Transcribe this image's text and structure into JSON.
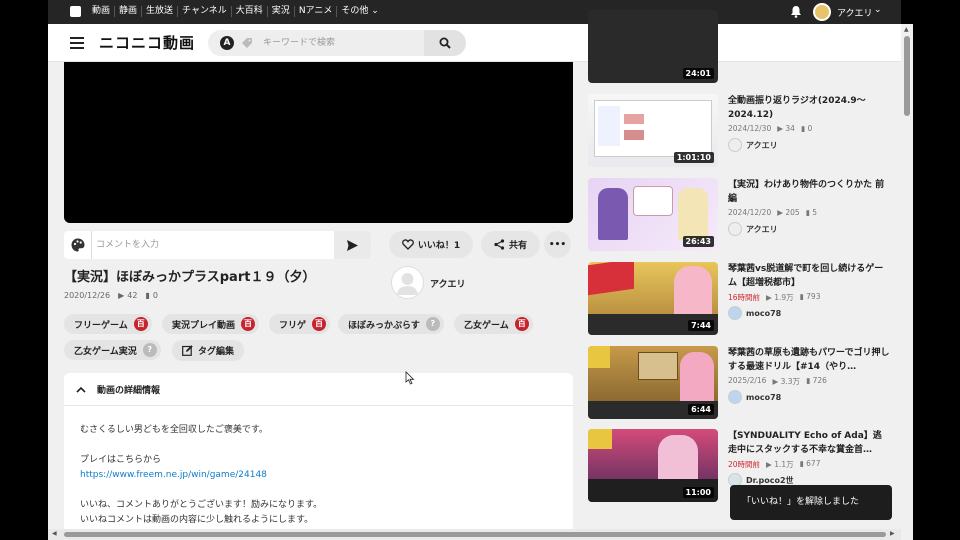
{
  "topbar": {
    "nav": [
      "動画",
      "静画",
      "生放送",
      "チャンネル",
      "大百科",
      "実況",
      "Nアニメ",
      "その他"
    ],
    "user_name": "アクエリ"
  },
  "header": {
    "brand": "ニコニコ動画",
    "search_placeholder": "キーワードで検索",
    "search_mode": "A"
  },
  "player": {
    "comment_placeholder": "コメントを入力",
    "like_label": "いいね！1",
    "share_label": "共有"
  },
  "video": {
    "title": "【実況】ほぼみっかプラスpart１９（夕）",
    "date": "2020/12/26",
    "views": "42",
    "comments": "0",
    "owner": "アクエリ"
  },
  "tags": [
    {
      "label": "フリーゲーム",
      "badge": "百",
      "badge_color": "red"
    },
    {
      "label": "実況プレイ動画",
      "badge": "百",
      "badge_color": "red"
    },
    {
      "label": "フリゲ",
      "badge": "百",
      "badge_color": "red"
    },
    {
      "label": "ほぼみっかぷらす",
      "badge": "?",
      "badge_color": "grey"
    },
    {
      "label": "乙女ゲーム",
      "badge": "百",
      "badge_color": "red"
    },
    {
      "label": "乙女ゲーム実況",
      "badge": "?",
      "badge_color": "grey"
    }
  ],
  "tag_edit_label": "タグ編集",
  "details": {
    "heading": "動画の詳細情報",
    "lines": [
      "むさくるしい男どもを全回収したご褒美です。",
      "",
      "プレイはこちらから",
      "https://www.freem.ne.jp/win/game/24148",
      "",
      "いいね、コメントありがとうございます！励みになります。",
      "いいねコメントは動画の内容に少し触れるようにします。"
    ]
  },
  "related": [
    {
      "title": "",
      "duration": "24:01",
      "date": "",
      "views": "",
      "comments": "",
      "author": ""
    },
    {
      "title": "全動画振り返りラジオ(2024.9～2024.12)",
      "duration": "1:01:10",
      "date": "2024/12/30",
      "views": "34",
      "comments": "0",
      "author": "アクエリ"
    },
    {
      "title": "【実況】わけあり物件のつくりかた 前編",
      "duration": "26:43",
      "date": "2024/12/20",
      "views": "205",
      "comments": "5",
      "author": "アクエリ"
    },
    {
      "title": "琴葉茜vs脱道解で町を回し続けるゲーム【超増税都市】",
      "duration": "7:44",
      "date": "16時間前",
      "views": "1.9万",
      "comments": "793",
      "author": "moco78"
    },
    {
      "title": "琴葉茜の草原も遺跡もパワーでゴリ押しする最速ドリル【#14（やり…",
      "duration": "6:44",
      "date": "2025/2/16",
      "views": "3.3万",
      "comments": "726",
      "author": "moco78"
    },
    {
      "title": "【SYNDUALITY Echo of Ada】逃走中にスタックする不幸な賞金首…",
      "duration": "11:00",
      "date": "20時間前",
      "views": "1.1万",
      "comments": "677",
      "author": "Dr.poco2世"
    }
  ],
  "toast": "「いいね！」を解除しました",
  "colors": {
    "accent_red": "#c8232c",
    "link": "#0b7ec9",
    "bar": "#252525"
  }
}
